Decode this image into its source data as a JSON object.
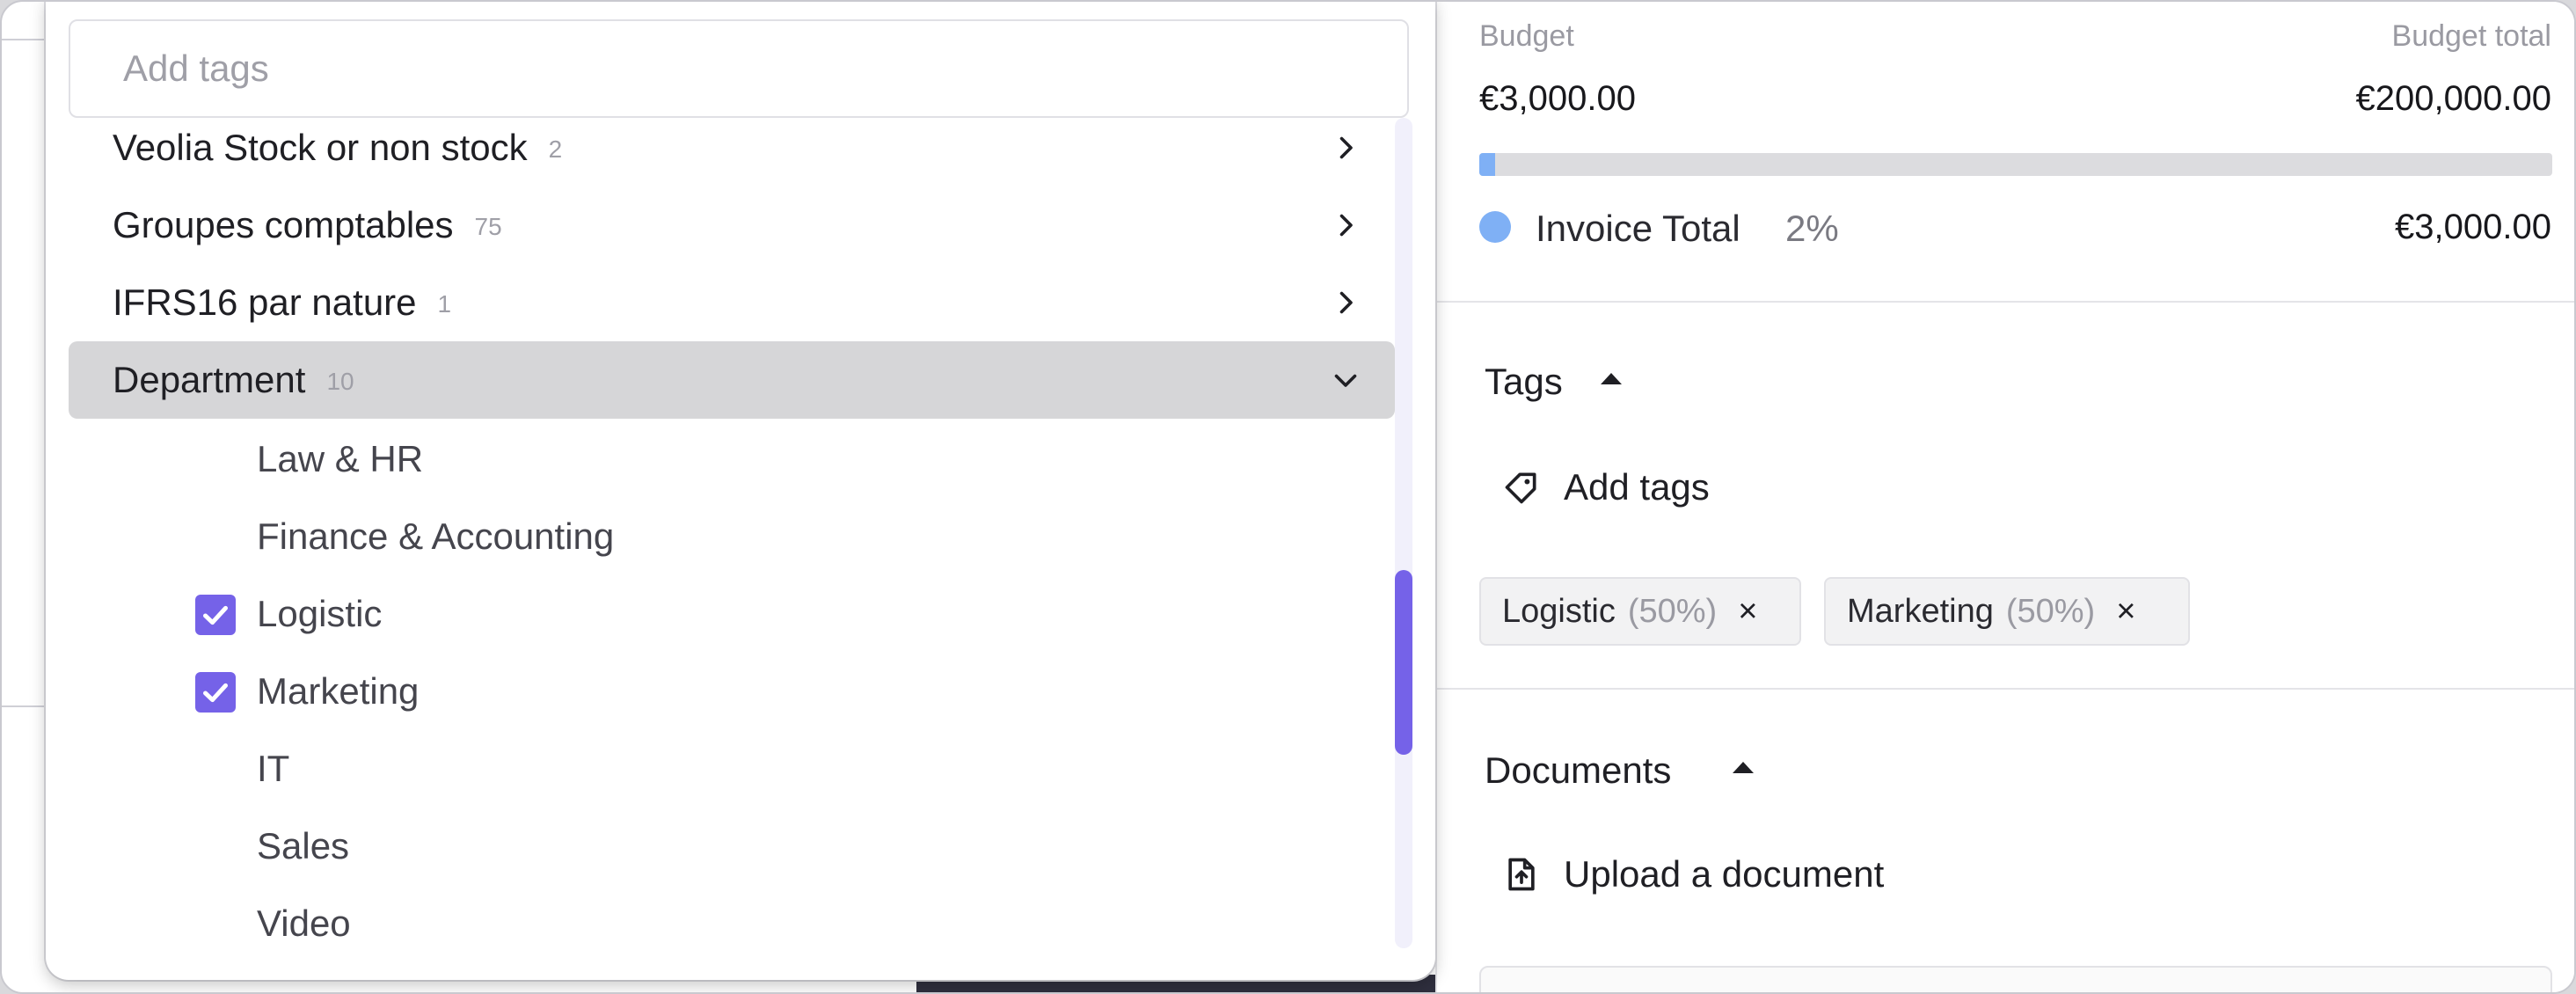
{
  "tag_picker": {
    "search_placeholder": "Add tags",
    "categories": [
      {
        "label": "Veolia Stock or non stock",
        "count": "2"
      },
      {
        "label": "Groupes comptables",
        "count": "75"
      },
      {
        "label": "IFRS16 par nature",
        "count": "1"
      },
      {
        "label": "Department",
        "count": "10"
      }
    ],
    "department_options": [
      {
        "label": "Law & HR",
        "checked": false
      },
      {
        "label": "Finance & Accounting",
        "checked": false
      },
      {
        "label": "Logistic",
        "checked": true
      },
      {
        "label": "Marketing",
        "checked": true
      },
      {
        "label": "IT",
        "checked": false
      },
      {
        "label": "Sales",
        "checked": false
      },
      {
        "label": "Video",
        "checked": false
      }
    ],
    "scroll_position": 0.7
  },
  "budget": {
    "budget_label": "Budget",
    "budget_total_label": "Budget total",
    "budget_value": "€3,000.00",
    "budget_total_value": "€200,000.00",
    "progress_fraction": 0.015,
    "invoice_total_label": "Invoice Total",
    "invoice_total_pct": "2%",
    "invoice_total_amount": "€3,000.00",
    "accent_color": "#7fb0f5"
  },
  "tags_section": {
    "title": "Tags",
    "add_label": "Add tags",
    "chips": [
      {
        "name": "Logistic",
        "share": "(50%)"
      },
      {
        "name": "Marketing",
        "share": "(50%)"
      }
    ],
    "remove_symbol": "×"
  },
  "documents_section": {
    "title": "Documents",
    "upload_label": "Upload a document"
  },
  "colors": {
    "checkbox": "#7562e8",
    "expanded_row": "#d6d6d8"
  }
}
